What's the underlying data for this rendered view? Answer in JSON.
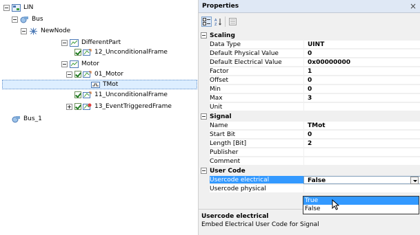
{
  "tree": {
    "root": "LIN",
    "bus": "Bus",
    "node": "NewNode",
    "different_part": "DifferentPart",
    "frame_12": "12_UnconditionalFrame",
    "motor": "Motor",
    "motor_01": "01_Motor",
    "signal_tmot": "TMot",
    "frame_11": "11_UnconditionalFrame",
    "frame_13": "13_EventTriggeredFrame",
    "bus_1": "Bus_1"
  },
  "properties": {
    "title": "Properties",
    "close": "×",
    "categories": {
      "scaling": "Scaling",
      "signal": "Signal",
      "usercode": "User Code"
    },
    "scaling_rows": [
      {
        "name": "Data Type",
        "value": "UINT"
      },
      {
        "name": "Default Physical Value",
        "value": "0"
      },
      {
        "name": "Default Electrical Value",
        "value": "0x00000000"
      },
      {
        "name": "Factor",
        "value": "1"
      },
      {
        "name": "Offset",
        "value": "0"
      },
      {
        "name": "Min",
        "value": "0"
      },
      {
        "name": "Max",
        "value": "3"
      },
      {
        "name": "Unit",
        "value": ""
      }
    ],
    "signal_rows": [
      {
        "name": "Name",
        "value": "TMot"
      },
      {
        "name": "Start Bit",
        "value": "0"
      },
      {
        "name": "Length [Bit]",
        "value": "2"
      },
      {
        "name": "Publisher",
        "value": ""
      },
      {
        "name": "Comment",
        "value": ""
      }
    ],
    "usercode_rows": [
      {
        "name": "Usercode electrical",
        "value": "False"
      },
      {
        "name": "Usercode physical",
        "value": ""
      }
    ],
    "dropdown_options": [
      "True",
      "False"
    ],
    "description_title": "Usercode electrical",
    "description_text": "Embed Electrical User Code for Signal"
  },
  "colors": {
    "selection": "#3399ff",
    "tree_selection": "#ddeeff",
    "panel_bg": "#f0f0f0"
  }
}
